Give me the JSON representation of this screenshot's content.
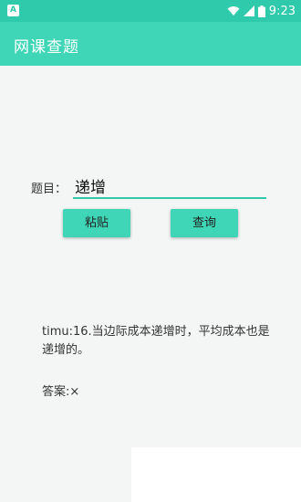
{
  "status_bar": {
    "notification_glyph": "A",
    "time": "9:23",
    "icons": [
      "wifi-icon",
      "signal-icon",
      "battery-icon"
    ]
  },
  "app_bar": {
    "title": "网课查题"
  },
  "query": {
    "label": "题目：",
    "value": "递增"
  },
  "buttons": {
    "paste": "粘贴",
    "search": "查询"
  },
  "result": {
    "text": "timu:16.当边际成本递增时，平均成本也是递增的。",
    "answer": "答案:×"
  },
  "colors": {
    "accent": "#3ed6b7",
    "status_bar": "#2fc9ac",
    "background": "#f4f6f5"
  }
}
